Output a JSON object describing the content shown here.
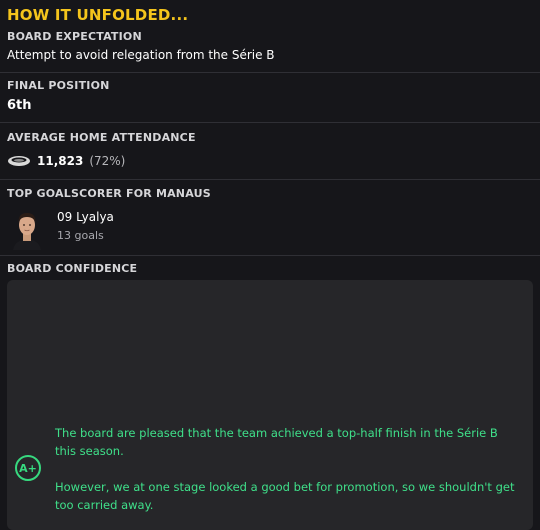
{
  "header": {
    "title": "HOW IT UNFOLDED..."
  },
  "board_expectation": {
    "label": "BOARD EXPECTATION",
    "value": "Attempt to avoid relegation from the Série B"
  },
  "final_position": {
    "label": "FINAL POSITION",
    "value": "6th"
  },
  "attendance": {
    "label": "AVERAGE HOME ATTENDANCE",
    "value": "11,823",
    "percent": "(72%)",
    "icon": "stadium-icon"
  },
  "top_scorer": {
    "label": "TOP GOALSCORER FOR MANAUS",
    "name": "09 Lyalya",
    "goals": "13 goals"
  },
  "board_confidence": {
    "label": "BOARD CONFIDENCE",
    "grade": "A+",
    "paragraph1": "The board are pleased that the team achieved a top-half finish in the Série B this season.",
    "paragraph2": "However, we at one stage looked a good bet for promotion, so we shouldn't get too carried away."
  },
  "colors": {
    "accent": "#f5c51c",
    "positive": "#3fe08a",
    "background": "#16161a",
    "panel": "#262629"
  }
}
